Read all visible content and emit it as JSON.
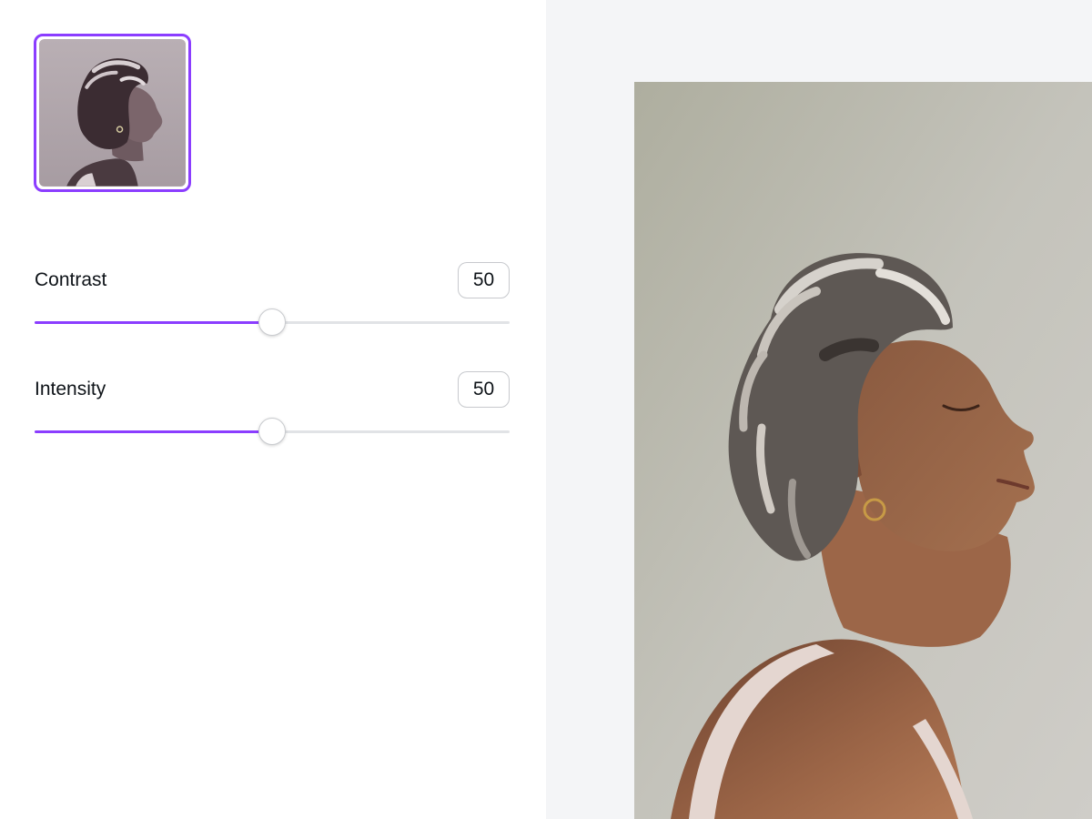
{
  "filter_thumbnail": {
    "selected": true,
    "tint_color": "#b2a8ad",
    "border_color": "#8b3dff"
  },
  "controls": {
    "contrast": {
      "label": "Contrast",
      "value": "50",
      "percent": 50
    },
    "intensity": {
      "label": "Intensity",
      "value": "50",
      "percent": 50
    }
  },
  "colors": {
    "accent": "#8b3dff",
    "canvas_background": "#f4f5f7",
    "track": "#e1e3e6"
  }
}
